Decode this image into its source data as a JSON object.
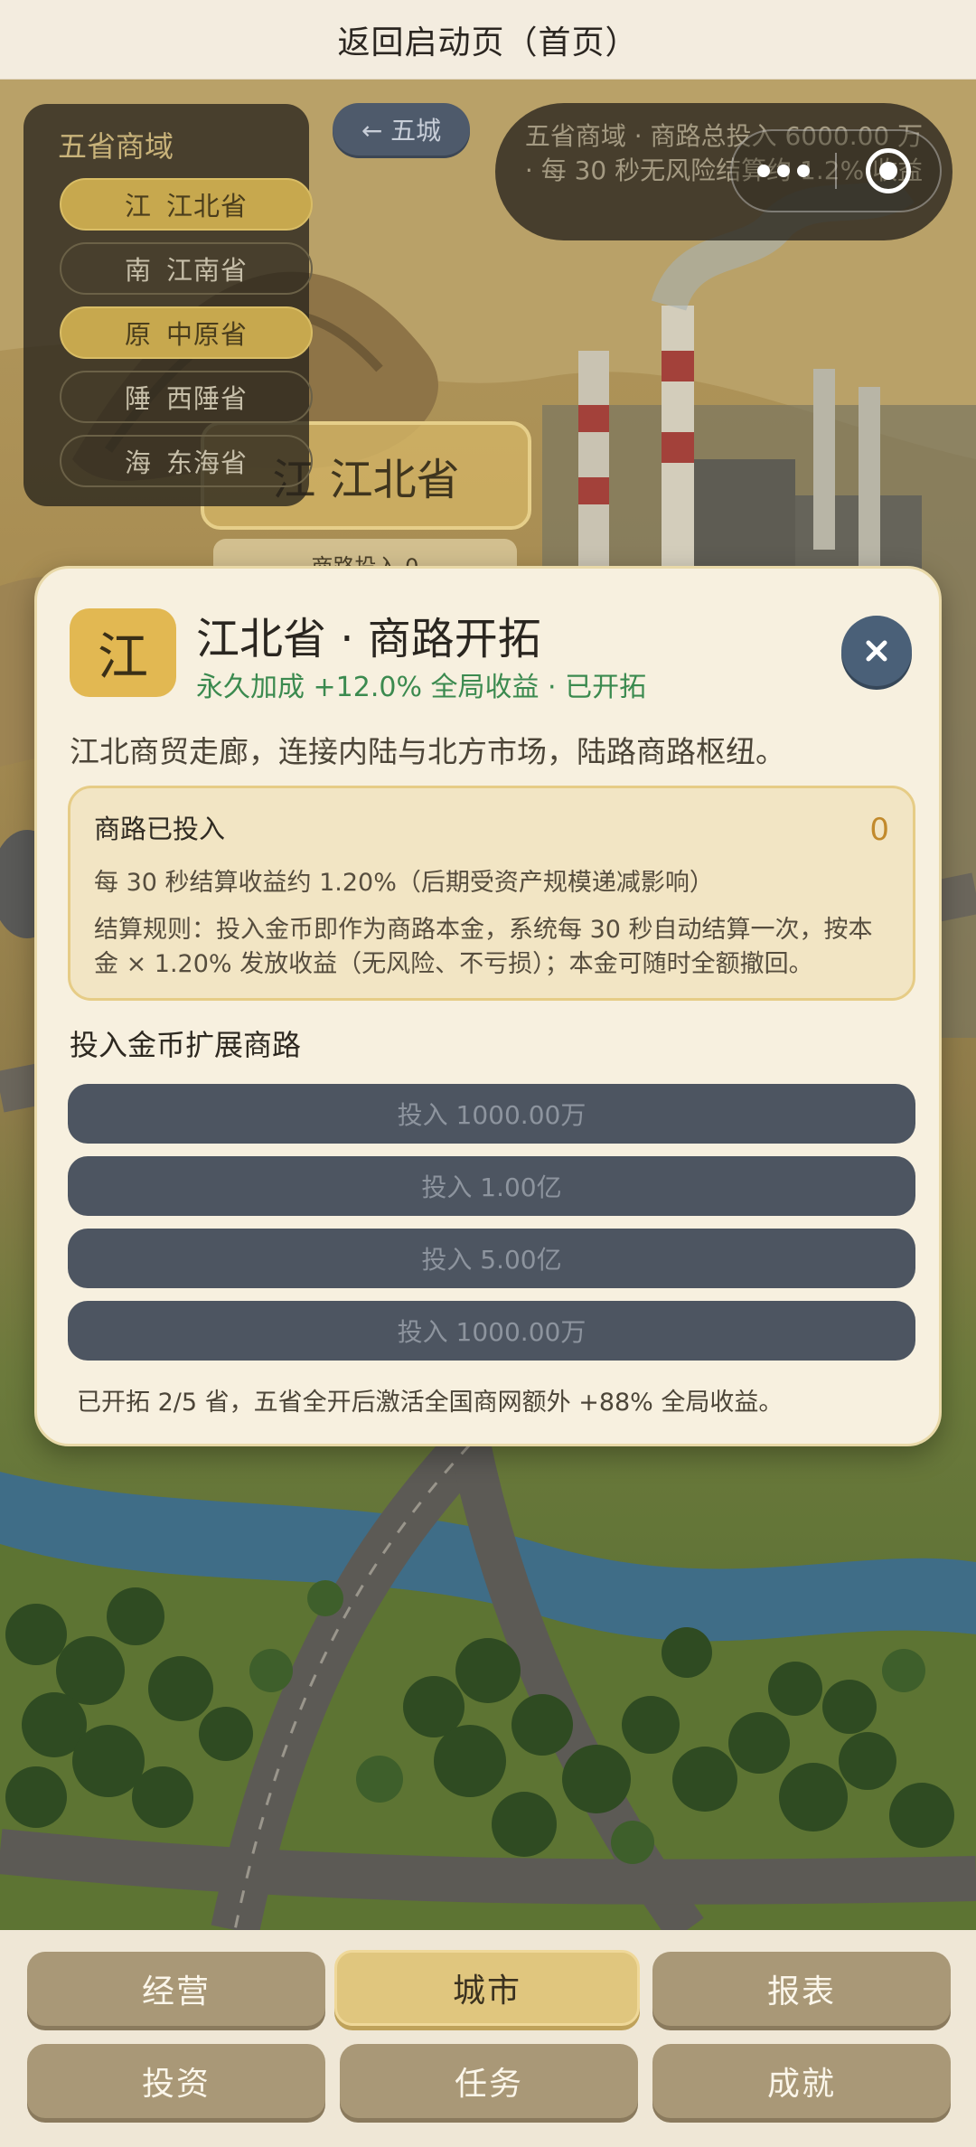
{
  "topbar": {
    "title": "返回启动页（首页）"
  },
  "province_panel": {
    "title": "五省商域",
    "items": [
      {
        "char": "江",
        "name": "江北省",
        "active": true
      },
      {
        "char": "南",
        "name": "江南省",
        "active": false
      },
      {
        "char": "原",
        "name": "中原省",
        "active": true
      },
      {
        "char": "陲",
        "name": "西陲省",
        "active": false
      },
      {
        "char": "海",
        "name": "东海省",
        "active": false
      }
    ]
  },
  "back_button": {
    "label": "← 五城"
  },
  "info_banner": {
    "text": "五省商域 · 商路总投入 6000.00 万 · 每 30 秒无风险结算约 1.2% 收益"
  },
  "map_labels": {
    "province": "江 江北省",
    "road_invest": "商路投入 0"
  },
  "modal": {
    "badge_char": "江",
    "title": "江北省 · 商路开拓",
    "subtitle": "永久加成 +12.0% 全局收益 · 已开拓",
    "close_icon": "close-icon",
    "description": "江北商贸走廊，连接内陆与北方市场，陆路商路枢纽。",
    "invest_box": {
      "title": "商路已投入",
      "value": "0",
      "rate": "每 30 秒结算收益约 1.20%（后期受资产规模递减影响）",
      "rule": "结算规则：投入金币即作为商路本金，系统每 30 秒自动结算一次，按本金 × 1.20% 发放收益（无风险、不亏损）；本金可随时全额撤回。"
    },
    "section_title": "投入金币扩展商路",
    "buttons": [
      "投入 1000.00万",
      "投入 1.00亿",
      "投入 5.00亿",
      "投入 1000.00万"
    ],
    "footnote": "已开拓 2/5 省，五省全开后激活全国商网额外 +88% 全局收益。"
  },
  "bottom_nav": {
    "items": [
      {
        "label": "经营",
        "active": false
      },
      {
        "label": "城市",
        "active": true
      },
      {
        "label": "报表",
        "active": false
      },
      {
        "label": "投资",
        "active": false
      },
      {
        "label": "任务",
        "active": false
      },
      {
        "label": "成就",
        "active": false
      }
    ]
  },
  "colors": {
    "accent_gold": "#e0c67e",
    "badge_gold": "#e2b852",
    "green_text": "#3b8a4f",
    "close_blue": "#4a6078",
    "invest_button": "#4d5561"
  }
}
